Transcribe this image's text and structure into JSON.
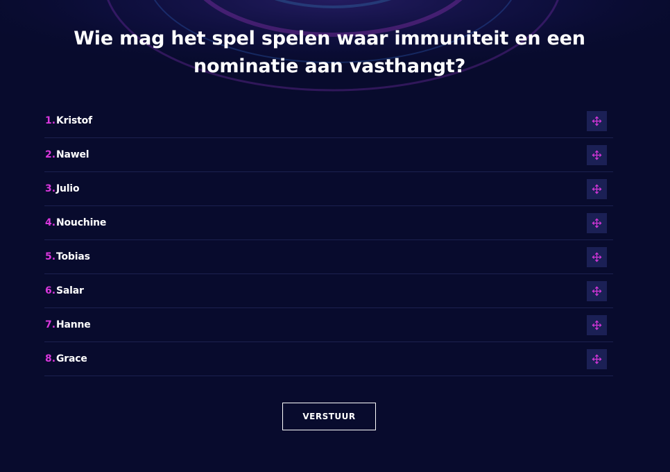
{
  "question": "Wie mag het spel spelen waar immuniteit en een nominatie aan vasthangt?",
  "candidates": [
    {
      "number": "1.",
      "name": "Kristof"
    },
    {
      "number": "2.",
      "name": "Nawel"
    },
    {
      "number": "3.",
      "name": "Julio"
    },
    {
      "number": "4.",
      "name": "Nouchine"
    },
    {
      "number": "5.",
      "name": "Tobias"
    },
    {
      "number": "6.",
      "name": "Salar"
    },
    {
      "number": "7.",
      "name": "Hanne"
    },
    {
      "number": "8.",
      "name": "Grace"
    }
  ],
  "drag_icon": "move-arrows-icon",
  "submit_label": "VERSTUUR",
  "colors": {
    "background": "#080b2d",
    "accent": "#d837dc",
    "handle_background": "#1b2055",
    "divider": "#1c2150",
    "text": "#ffffff"
  }
}
